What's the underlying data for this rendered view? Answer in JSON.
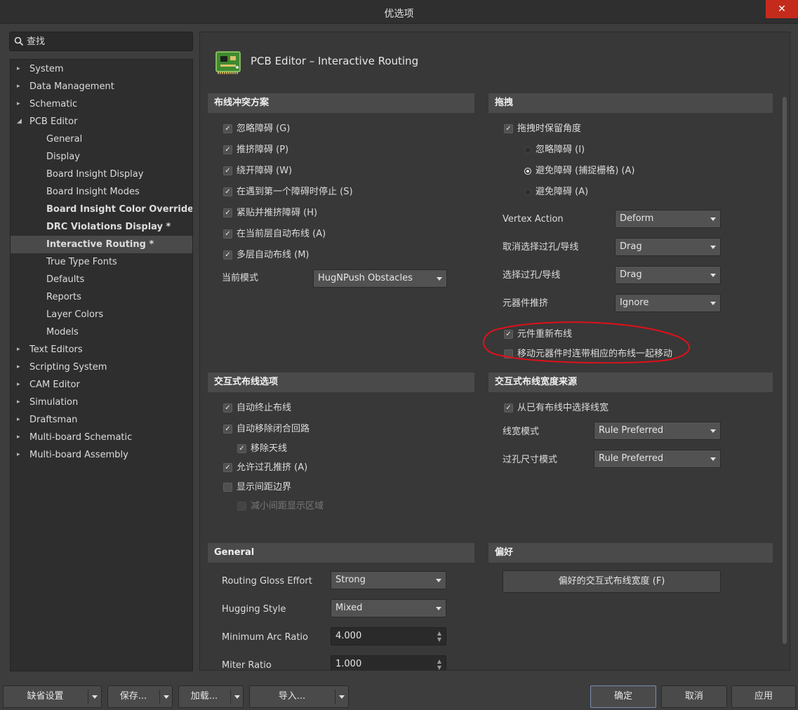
{
  "window": {
    "title": "优选项",
    "close_label": "✕"
  },
  "search": {
    "placeholder": "查找"
  },
  "tree": [
    {
      "label": "System",
      "level": 0,
      "arrow": "▸"
    },
    {
      "label": "Data Management",
      "level": 0,
      "arrow": "▸"
    },
    {
      "label": "Schematic",
      "level": 0,
      "arrow": "▸"
    },
    {
      "label": "PCB Editor",
      "level": 0,
      "arrow": "◢"
    },
    {
      "label": "General",
      "level": 1
    },
    {
      "label": "Display",
      "level": 1
    },
    {
      "label": "Board Insight Display",
      "level": 1
    },
    {
      "label": "Board Insight Modes",
      "level": 1
    },
    {
      "label": "Board Insight Color Overrides *",
      "level": 1,
      "bold": true
    },
    {
      "label": "DRC Violations Display *",
      "level": 1,
      "bold": true
    },
    {
      "label": "Interactive Routing *",
      "level": 1,
      "bold": true,
      "selected": true
    },
    {
      "label": "True Type Fonts",
      "level": 1
    },
    {
      "label": "Defaults",
      "level": 1
    },
    {
      "label": "Reports",
      "level": 1
    },
    {
      "label": "Layer Colors",
      "level": 1
    },
    {
      "label": "Models",
      "level": 1
    },
    {
      "label": "Text Editors",
      "level": 0,
      "arrow": "▸"
    },
    {
      "label": "Scripting System",
      "level": 0,
      "arrow": "▸"
    },
    {
      "label": "CAM Editor",
      "level": 0,
      "arrow": "▸"
    },
    {
      "label": "Simulation",
      "level": 0,
      "arrow": "▸"
    },
    {
      "label": "Draftsman",
      "level": 0,
      "arrow": "▸"
    },
    {
      "label": "Multi-board Schematic",
      "level": 0,
      "arrow": "▸"
    },
    {
      "label": "Multi-board Assembly",
      "level": 0,
      "arrow": "▸"
    }
  ],
  "panel": {
    "title": "PCB Editor – Interactive Routing",
    "routing_conflict": {
      "header": "布线冲突方案",
      "options": [
        {
          "label": "忽略障碍 (G)",
          "checked": true
        },
        {
          "label": "推挤障碍 (P)",
          "checked": true
        },
        {
          "label": "绕开障碍 (W)",
          "checked": true
        },
        {
          "label": "在遇到第一个障碍时停止 (S)",
          "checked": true
        },
        {
          "label": "紧贴并推挤障碍 (H)",
          "checked": true
        },
        {
          "label": "在当前层自动布线 (A)",
          "checked": true
        },
        {
          "label": "多层自动布线 (M)",
          "checked": true
        }
      ],
      "mode_label": "当前模式",
      "mode_value": "HugNPush Obstacles"
    },
    "drag": {
      "header": "拖拽",
      "preserve_angle": {
        "label": "拖拽时保留角度",
        "checked": true
      },
      "radios": [
        {
          "label": "忽略障碍 (I)",
          "selected": false
        },
        {
          "label": "避免障碍 (捕捉栅格) (A)",
          "selected": true
        },
        {
          "label": "避免障碍 (A)",
          "selected": false
        }
      ],
      "fields": [
        {
          "label": "Vertex Action",
          "value": "Deform"
        },
        {
          "label": "取消选择过孔/导线",
          "value": "Drag"
        },
        {
          "label": "选择过孔/导线",
          "value": "Drag"
        },
        {
          "label": "元器件推挤",
          "value": "Ignore"
        }
      ],
      "component_reroute": {
        "label": "元件重新布线",
        "checked": true
      },
      "move_with_tracks": {
        "label": "移动元器件时连带相应的布线一起移动",
        "checked": false
      }
    },
    "interactive_options": {
      "header": "交互式布线选项",
      "options": [
        {
          "label": "自动终止布线",
          "checked": true,
          "disabled": false
        },
        {
          "label": "自动移除闭合回路",
          "checked": true,
          "disabled": false
        },
        {
          "label": "移除天线",
          "checked": true,
          "disabled": false
        },
        {
          "label": "允许过孔推挤 (A)",
          "checked": true,
          "disabled": false
        },
        {
          "label": "显示间距边界",
          "checked": false,
          "disabled": false
        },
        {
          "label": "减小间距显示区域",
          "checked": false,
          "disabled": true
        }
      ]
    },
    "width_source": {
      "header": "交互式布线宽度来源",
      "pick_existing": {
        "label": "从已有布线中选择线宽",
        "checked": true
      },
      "fields": [
        {
          "label": "线宽模式",
          "value": "Rule Preferred"
        },
        {
          "label": "过孔尺寸模式",
          "value": "Rule Preferred"
        }
      ]
    },
    "general": {
      "header": "General",
      "fields": [
        {
          "label": "Routing Gloss Effort",
          "value": "Strong"
        },
        {
          "label": "Hugging Style",
          "value": "Mixed"
        }
      ],
      "spinners": [
        {
          "label": "Minimum Arc Ratio",
          "value": "4.000"
        },
        {
          "label": "Miter Ratio",
          "value": "1.000"
        }
      ]
    },
    "preferences": {
      "header": "偏好",
      "button": "偏好的交互式布线宽度 (F)"
    }
  },
  "footer": {
    "defaults": "缺省设置",
    "save": "保存...",
    "load": "加载...",
    "import": "导入...",
    "ok": "确定",
    "cancel": "取消",
    "apply": "应用"
  },
  "colors": {
    "annotation_oval": "#e0101a",
    "close_button": "#c42b1c"
  }
}
